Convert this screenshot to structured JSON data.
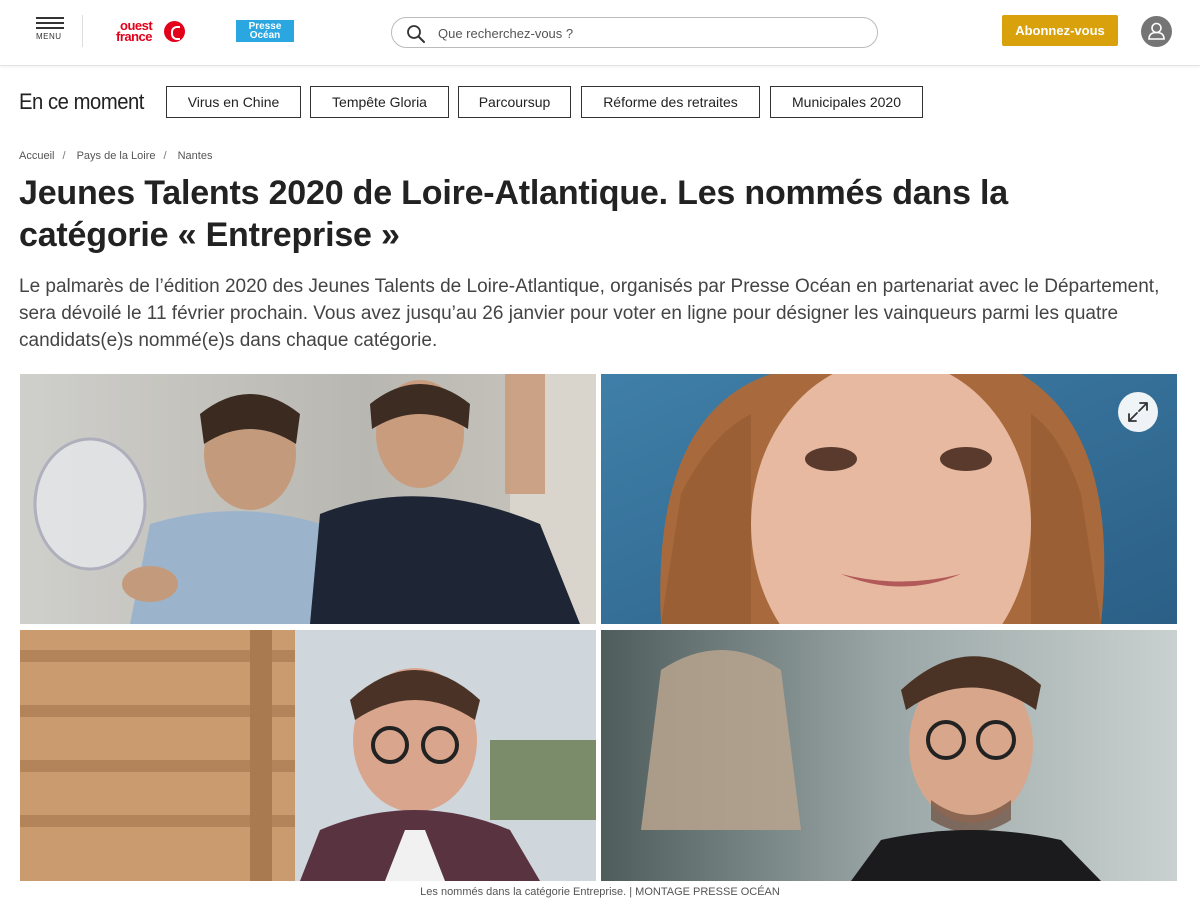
{
  "header": {
    "menu_label": "MENU",
    "logo_ouestfrance_line1": "ouest",
    "logo_ouestfrance_line2": "france",
    "logo_presseocean_line1": "Presse",
    "logo_presseocean_line2": "Océan",
    "search_placeholder": "Que recherchez-vous ?",
    "subscribe_label": "Abonnez-vous",
    "accent_color": "#d9a10b",
    "brand_red": "#e2001a",
    "brand_blue": "#2aa6e0"
  },
  "trending": {
    "title": "En ce moment",
    "chips": [
      {
        "label": "Virus en Chine"
      },
      {
        "label": "Tempête Gloria"
      },
      {
        "label": "Parcoursup"
      },
      {
        "label": "Réforme des retraites"
      },
      {
        "label": "Municipales 2020"
      }
    ]
  },
  "breadcrumb": [
    "Accueil",
    "Pays de la Loire",
    "Nantes"
  ],
  "article": {
    "title": "Jeunes Talents 2020 de Loire-Atlantique. Les nommés dans la catégorie « Entreprise »",
    "lede": "Le palmarès de l’édition 2020 des Jeunes Talents de Loire-Atlantique, organisés par Presse Océan en partenariat avec le Département, sera dévoilé le 11 février prochain. Vous avez jusqu’au 26 janvier pour voter en ligne pour désigner les vainqueurs parmi les quatre candidats(e)s nommé(e)s dans chaque catégorie.",
    "photo_caption": "Les nommés dans la catégorie Entreprise. | MONTAGE PRESSE OCÉAN",
    "expand_icon": "expand-icon"
  }
}
